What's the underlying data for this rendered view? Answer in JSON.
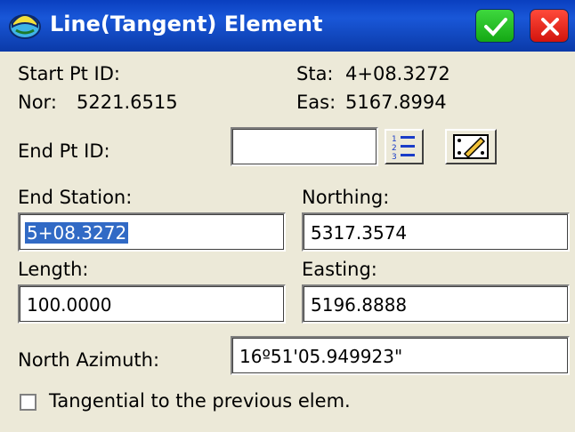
{
  "window": {
    "title": "Line(Tangent) Element",
    "ok_icon": "checkmark-icon",
    "close_icon": "close-icon"
  },
  "info": {
    "start_pt_label": "Start Pt ID:",
    "sta_label": "Sta:",
    "sta_value": "4+08.3272",
    "nor_label": "Nor:",
    "nor_value": "5221.6515",
    "eas_label": "Eas:",
    "eas_value": "5167.8994"
  },
  "end_pt": {
    "label": "End Pt ID:",
    "value": "",
    "list_icon": "list-icon",
    "map_icon": "map-pick-icon"
  },
  "end_station": {
    "label": "End Station:",
    "value": "5+08.3272"
  },
  "northing": {
    "label": "Northing:",
    "value": "5317.3574"
  },
  "length": {
    "label": "Length:",
    "value": "100.0000"
  },
  "easting": {
    "label": "Easting:",
    "value": "5196.8888"
  },
  "azimuth": {
    "label": "North Azimuth:",
    "value": "16º51'05.949923\""
  },
  "tangential": {
    "label": "Tangential to the previous elem.",
    "checked": false
  },
  "colors": {
    "titlebar": "#1957d8",
    "ok": "#14a814",
    "close": "#d2140d",
    "selection": "#316ac5"
  }
}
